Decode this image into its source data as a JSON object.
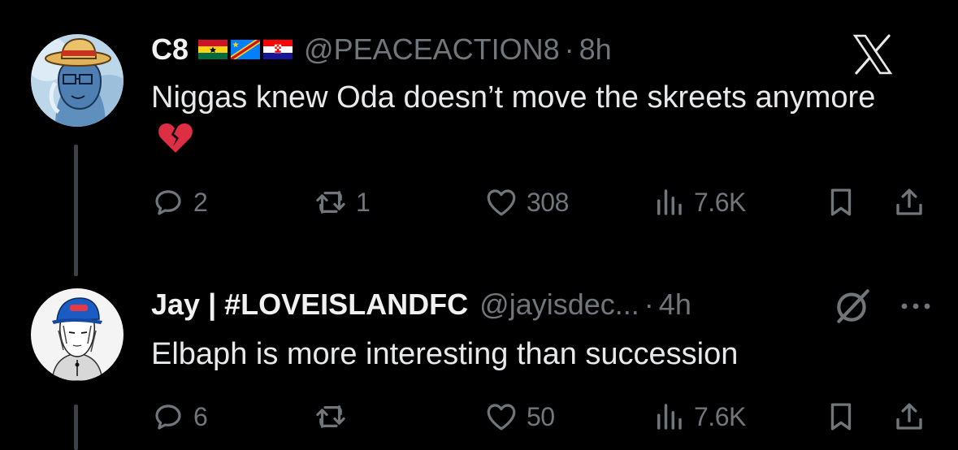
{
  "tweets": [
    {
      "display_name": "C8",
      "flags": [
        "ghana-flag",
        "dr-congo-flag",
        "croatia-flag"
      ],
      "handle": "@PEACEACTION8",
      "separator": "·",
      "time": "8h",
      "text": "Niggas knew Oda doesn’t move the skreets anymore",
      "emoji": "broken-heart-icon",
      "actions": {
        "replies": "2",
        "reposts": "1",
        "likes": "308",
        "views": "7.6K"
      }
    },
    {
      "display_name": "Jay | #LOVEISLANDFC",
      "handle": "@jayisdec...",
      "separator": "·",
      "time": "4h",
      "text": "Elbaph is more interesting than succession",
      "actions": {
        "replies": "6",
        "reposts": "",
        "likes": "50",
        "views": "7.6K"
      }
    }
  ],
  "icons": {
    "brand": "x-logo-icon",
    "grok": "grok-icon",
    "more": "more-icon",
    "reply": "reply-icon",
    "repost": "repost-icon",
    "like": "heart-icon",
    "views": "views-icon",
    "bookmark": "bookmark-icon",
    "share": "share-icon"
  },
  "colors": {
    "background": "#000000",
    "text": "#e7e9ea",
    "secondary": "#71767b",
    "thread_line": "#3d4145"
  }
}
